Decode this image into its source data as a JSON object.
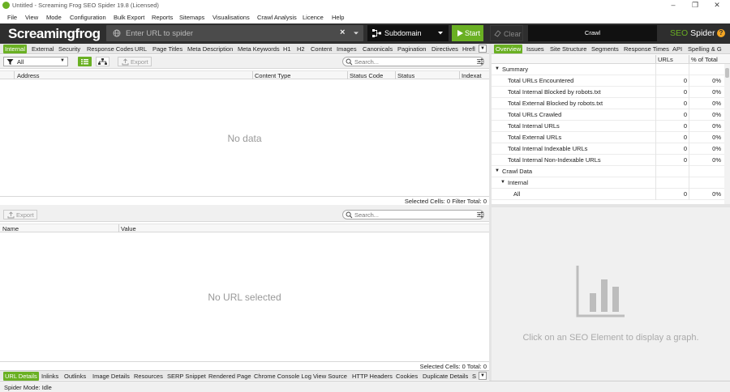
{
  "window": {
    "title": "Untitled - Screaming Frog SEO Spider 19.8 (Licensed)",
    "controls": {
      "minimize": "–",
      "maximize": "❐",
      "close": "✕"
    }
  },
  "menu": [
    "File",
    "View",
    "Mode",
    "Configuration",
    "Bulk Export",
    "Reports",
    "Sitemaps",
    "Visualisations",
    "Crawl Analysis",
    "Licence",
    "Help"
  ],
  "toolbar": {
    "brand": "Screamingfrog",
    "url_placeholder": "Enter URL to spider",
    "mode": "Subdomain",
    "start_label": "Start",
    "clear_label": "Clear",
    "crawl_label": "Crawl",
    "seo_label": "SEO",
    "spider_label": "Spider",
    "help_glyph": "?"
  },
  "left_tabs": {
    "items": [
      "Internal",
      "External",
      "Security",
      "Response Codes",
      "URL",
      "Page Titles",
      "Meta Description",
      "Meta Keywords",
      "H1",
      "H2",
      "Content",
      "Images",
      "Canonicals",
      "Pagination",
      "Directives",
      "Hrefl"
    ],
    "active": "Internal"
  },
  "filter": {
    "value": "All",
    "export_label": "Export",
    "search_placeholder": "Search..."
  },
  "top_grid": {
    "columns": [
      "Address",
      "Content Type",
      "Status Code",
      "Status",
      "Indexat"
    ],
    "empty_text": "No data",
    "status": "Selected Cells:  0  Filter Total:  0"
  },
  "lower_panel": {
    "export_label": "Export",
    "search_placeholder": "Search...",
    "columns": [
      "Name",
      "Value"
    ],
    "empty_text": "No URL selected",
    "status": "Selected Cells:  0  Total:  0"
  },
  "right_tabs": {
    "items": [
      "Overview",
      "Issues",
      "Site Structure",
      "Segments",
      "Response Times",
      "API",
      "Spelling & G"
    ],
    "active": "Overview"
  },
  "overview": {
    "col_urls": "URLs",
    "col_pct": "% of Total",
    "summary_label": "Summary",
    "summary_rows": [
      {
        "label": "Total URLs Encountered",
        "urls": "0",
        "pct": "0%"
      },
      {
        "label": "Total Internal Blocked by robots.txt",
        "urls": "0",
        "pct": "0%"
      },
      {
        "label": "Total External Blocked by robots.txt",
        "urls": "0",
        "pct": "0%"
      },
      {
        "label": "Total URLs Crawled",
        "urls": "0",
        "pct": "0%"
      },
      {
        "label": "Total Internal URLs",
        "urls": "0",
        "pct": "0%"
      },
      {
        "label": "Total External URLs",
        "urls": "0",
        "pct": "0%"
      },
      {
        "label": "Total Internal Indexable URLs",
        "urls": "0",
        "pct": "0%"
      },
      {
        "label": "Total Internal Non-Indexable URLs",
        "urls": "0",
        "pct": "0%"
      }
    ],
    "crawl_data_label": "Crawl Data",
    "internal_label": "Internal",
    "all_row": {
      "label": "All",
      "urls": "0",
      "pct": "0%"
    }
  },
  "graph_panel": {
    "placeholder": "Click on an SEO Element to display a graph."
  },
  "bottom_tabs": {
    "items": [
      "URL Details",
      "Inlinks",
      "Outlinks",
      "Image Details",
      "Resources",
      "SERP Snippet",
      "Rendered Page",
      "Chrome Console Log",
      "View Source",
      "HTTP Headers",
      "Cookies",
      "Duplicate Details",
      "S"
    ],
    "active": "URL Details"
  },
  "statusbar": {
    "text": "Spider Mode: Idle"
  },
  "colors": {
    "accent": "#6ab023",
    "toolbar_bg": "#2e2e2e",
    "help": "#f5a623"
  }
}
